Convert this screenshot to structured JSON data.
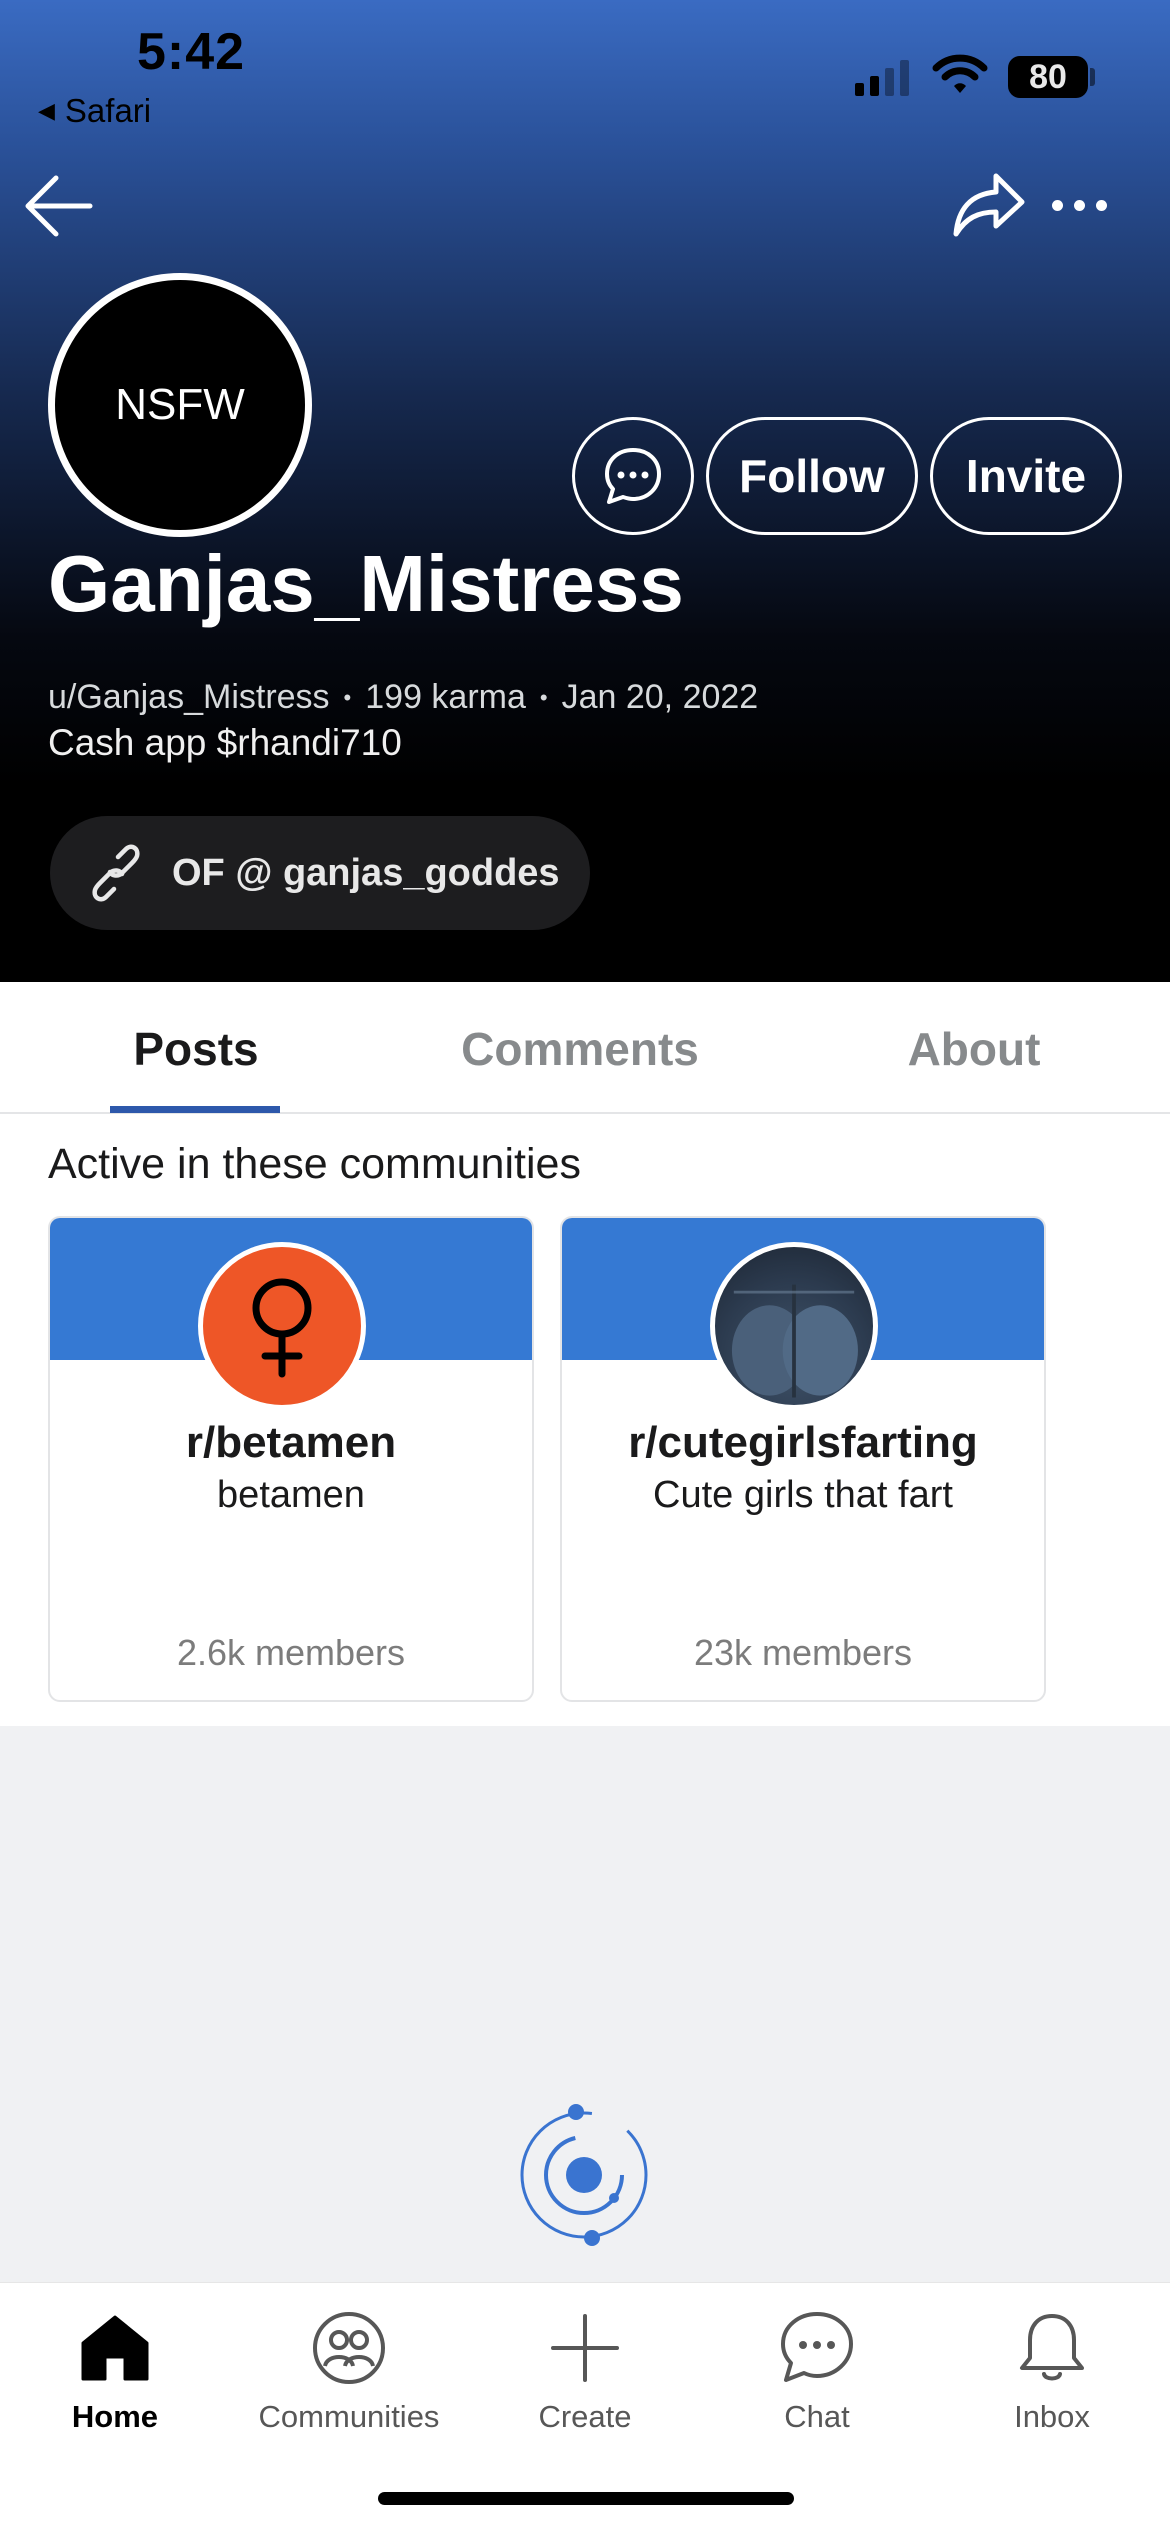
{
  "status_bar": {
    "time": "5:42",
    "back_app": "Safari",
    "battery": "80"
  },
  "profile": {
    "avatar_text": "NSFW",
    "display_name": "Ganjas_Mistress",
    "handle": "u/Ganjas_Mistress",
    "karma": "199 karma",
    "joined": "Jan 20, 2022",
    "bio": "Cash app $rhandi710",
    "link_label": "OF @ ganjas_goddes",
    "follow_label": "Follow",
    "invite_label": "Invite"
  },
  "tabs": [
    {
      "label": "Posts",
      "active": true
    },
    {
      "label": "Comments",
      "active": false
    },
    {
      "label": "About",
      "active": false
    }
  ],
  "communities": {
    "title": "Active in these communities",
    "cards": [
      {
        "name": "r/betamen",
        "description": "betamen",
        "members": "2.6k members",
        "icon": "female-symbol-icon"
      },
      {
        "name": "r/cutegirlsfarting",
        "description": "Cute girls that fart",
        "members": "23k members",
        "icon": "community-photo"
      }
    ]
  },
  "bottom_nav": [
    {
      "label": "Home",
      "icon": "home-icon",
      "active": true
    },
    {
      "label": "Communities",
      "icon": "communities-icon",
      "active": false
    },
    {
      "label": "Create",
      "icon": "plus-icon",
      "active": false
    },
    {
      "label": "Chat",
      "icon": "chat-icon",
      "active": false
    },
    {
      "label": "Inbox",
      "icon": "bell-icon",
      "active": false
    }
  ],
  "colors": {
    "accent": "#2d58ab",
    "banner_blue": "#3579d3",
    "community_orange": "#ee5627",
    "header_top": "#3a6bc2"
  }
}
